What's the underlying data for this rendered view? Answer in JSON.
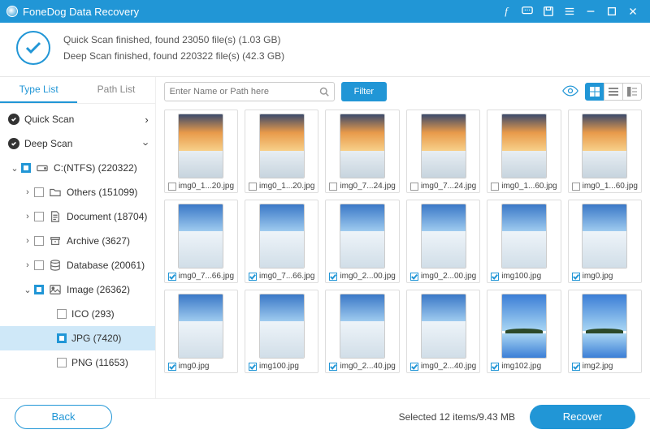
{
  "app": {
    "title": "FoneDog Data Recovery"
  },
  "summary": {
    "line1": "Quick Scan finished, found 23050 file(s) (1.03 GB)",
    "line2": "Deep Scan finished, found 220322 file(s) (42.3 GB)"
  },
  "sidebar": {
    "tabs": {
      "type_list": "Type List",
      "path_list": "Path List"
    },
    "quick_scan": "Quick Scan",
    "deep_scan": "Deep Scan",
    "drive": "C:(NTFS) (220322)",
    "nodes": {
      "others": "Others (151099)",
      "document": "Document (18704)",
      "archive": "Archive (3627)",
      "database": "Database (20061)",
      "image": "Image (26362)",
      "ico": "ICO (293)",
      "jpg": "JPG (7420)",
      "png": "PNG (11653)"
    }
  },
  "toolbar": {
    "search_placeholder": "Enter Name or Path here",
    "filter": "Filter"
  },
  "files": [
    {
      "name": "img0_1...20.jpg",
      "checked": false,
      "style": "sunset"
    },
    {
      "name": "img0_1...20.jpg",
      "checked": false,
      "style": "sunset"
    },
    {
      "name": "img0_7...24.jpg",
      "checked": false,
      "style": "sunset"
    },
    {
      "name": "img0_7...24.jpg",
      "checked": false,
      "style": "sunset"
    },
    {
      "name": "img0_1...60.jpg",
      "checked": false,
      "style": "sunset"
    },
    {
      "name": "img0_1...60.jpg",
      "checked": false,
      "style": "sunset"
    },
    {
      "name": "img0_7...66.jpg",
      "checked": true,
      "style": "day"
    },
    {
      "name": "img0_7...66.jpg",
      "checked": true,
      "style": "day"
    },
    {
      "name": "img0_2...00.jpg",
      "checked": true,
      "style": "day"
    },
    {
      "name": "img0_2...00.jpg",
      "checked": true,
      "style": "day"
    },
    {
      "name": "img100.jpg",
      "checked": true,
      "style": "day"
    },
    {
      "name": "img0.jpg",
      "checked": true,
      "style": "day"
    },
    {
      "name": "img0.jpg",
      "checked": true,
      "style": "day"
    },
    {
      "name": "img100.jpg",
      "checked": true,
      "style": "day"
    },
    {
      "name": "img0_2...40.jpg",
      "checked": true,
      "style": "day"
    },
    {
      "name": "img0_2...40.jpg",
      "checked": true,
      "style": "day"
    },
    {
      "name": "img102.jpg",
      "checked": true,
      "style": "island"
    },
    {
      "name": "img2.jpg",
      "checked": true,
      "style": "island"
    }
  ],
  "footer": {
    "back": "Back",
    "selected": "Selected 12 items/9.43 MB",
    "recover": "Recover"
  }
}
